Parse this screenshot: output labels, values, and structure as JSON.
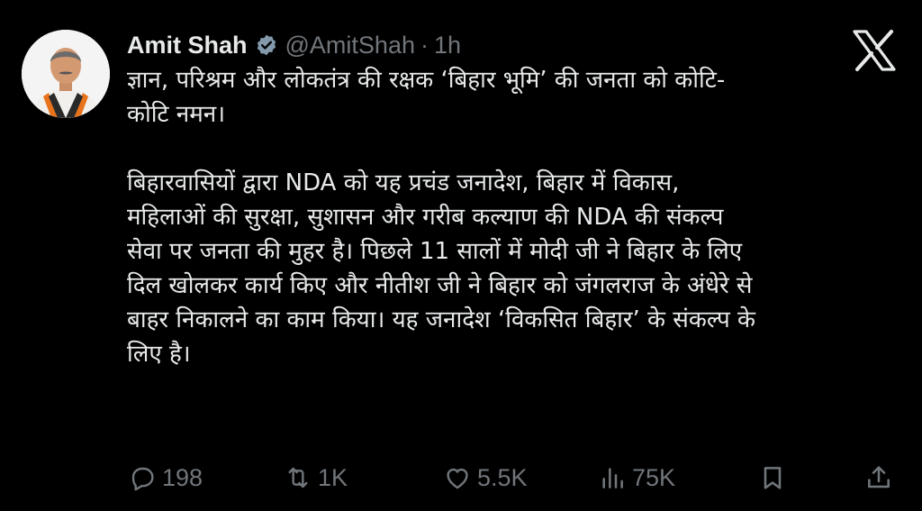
{
  "author": {
    "name": "Amit Shah",
    "handle": "@AmitShah",
    "separator": "·",
    "time": "1h",
    "verified": true
  },
  "tweet": {
    "text": "ज्ञान, परिश्रम और लोकतंत्र की रक्षक ‘बिहार भूमि’ की जनता को कोटि-\nकोटि नमन।\n\nबिहारवासियों द्वारा NDA को यह प्रचंड जनादेश, बिहार में विकास,\nमहिलाओं की सुरक्षा, सुशासन और गरीब कल्याण की NDA की संकल्प\nसेवा पर जनता की मुहर है। पिछले 11 सालों में मोदी जी ने बिहार के लिए\nदिल खोलकर कार्य किए और नीतीश जी ने बिहार को जंगलराज के अंधेरे से\nबाहर निकालने का काम किया। यह जनादेश ‘विकसित बिहार’ के संकल्प के\nलिए है।"
  },
  "metrics": {
    "replies": "198",
    "reposts": "1K",
    "likes": "5.5K",
    "views": "75K"
  },
  "icons": {
    "reply": "reply-icon",
    "repost": "repost-icon",
    "like": "heart-icon",
    "views": "analytics-icon",
    "bookmark": "bookmark-icon",
    "share": "share-icon",
    "logo": "x-logo-icon",
    "verified": "verified-badge-icon"
  },
  "colors": {
    "background": "#000000",
    "text": "#e7e9ea",
    "muted": "#71767b"
  }
}
